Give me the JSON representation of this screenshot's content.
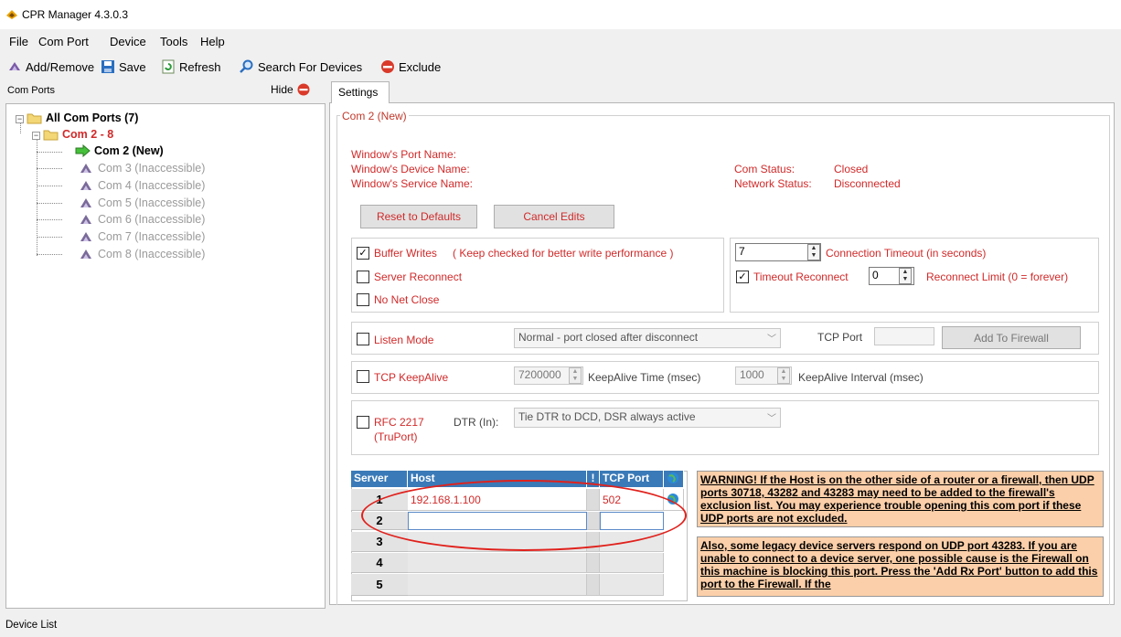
{
  "window": {
    "title": "CPR Manager 4.3.0.3"
  },
  "menu": [
    "File",
    "Com Port",
    "Device",
    "Tools",
    "Help"
  ],
  "toolbar": {
    "add_remove": "Add/Remove",
    "save": "Save",
    "refresh": "Refresh",
    "search": "Search For Devices",
    "exclude": "Exclude"
  },
  "left_pane": {
    "title": "Com Ports",
    "hide": "Hide",
    "tree": {
      "root": "All Com Ports (7)",
      "group": "Com 2 - 8",
      "items": [
        {
          "label": "Com 2 (New)"
        },
        {
          "label": "Com 3 (Inaccessible)"
        },
        {
          "label": "Com 4 (Inaccessible)"
        },
        {
          "label": "Com 5 (Inaccessible)"
        },
        {
          "label": "Com 6 (Inaccessible)"
        },
        {
          "label": "Com 7 (Inaccessible)"
        },
        {
          "label": "Com 8 (Inaccessible)"
        }
      ]
    }
  },
  "tab": {
    "label": "Settings"
  },
  "settings": {
    "group_title": "Com 2 (New)",
    "port_name_label": "Window's Port Name:",
    "device_name_label": "Window's Device Name:",
    "service_name_label": "Window's Service Name:",
    "com_status_label": "Com Status:",
    "com_status_value": "Closed",
    "network_status_label": "Network Status:",
    "network_status_value": "Disconnected",
    "reset_button": "Reset to Defaults",
    "cancel_button": "Cancel Edits",
    "buffer_writes": "Buffer Writes",
    "buffer_writes_note": "( Keep checked for better write performance )",
    "server_reconnect": "Server Reconnect",
    "no_net_close": "No Net Close",
    "connection_timeout_value": "7",
    "connection_timeout_label": "Connection Timeout (in seconds)",
    "timeout_reconnect": "Timeout Reconnect",
    "reconnect_limit_value": "0",
    "reconnect_limit_label": "Reconnect Limit (0 = forever)",
    "listen_mode": "Listen Mode",
    "listen_mode_option": "Normal - port closed after disconnect",
    "tcp_port_label": "TCP Port",
    "add_to_firewall": "Add To Firewall",
    "tcp_keepalive": "TCP KeepAlive",
    "keepalive_time_value": "7200000",
    "keepalive_time_label": "KeepAlive Time (msec)",
    "keepalive_interval_value": "1000",
    "keepalive_interval_label": "KeepAlive Interval (msec)",
    "rfc2217_line1": "RFC 2217",
    "rfc2217_line2": "(TruPort)",
    "dtr_label": "DTR (In):",
    "dtr_option": "Tie DTR to DCD, DSR always active"
  },
  "grid": {
    "headers": {
      "server": "Server",
      "host": "Host",
      "bang": "!",
      "tcp_port": "TCP Port"
    },
    "rows": [
      {
        "n": "1",
        "host": "192.168.1.100",
        "port": "502"
      },
      {
        "n": "2",
        "host": "",
        "port": ""
      },
      {
        "n": "3",
        "host": "",
        "port": ""
      },
      {
        "n": "4",
        "host": "",
        "port": ""
      },
      {
        "n": "5",
        "host": "",
        "port": ""
      }
    ]
  },
  "warnings": {
    "w1": "WARNING! If the Host is on the other side of a router or a firewall, then UDP ports 30718, 43282 and 43283 may need to be added to the firewall's exclusion list. You may experience trouble opening this com port if these UDP ports are not excluded.",
    "w2": "Also, some legacy device servers respond on UDP port 43283. If you are unable to connect to a device server, one possible cause is the Firewall on this machine is blocking this port. Press the 'Add Rx Port' button to add this port to the Firewall. If the"
  },
  "status_bar": {
    "label": "Device List"
  },
  "colors": {
    "accent_red": "#d12a2a",
    "grid_header": "#3a7ab8",
    "warning_bg": "#fbcfa9",
    "annotation": "#e0211c"
  }
}
